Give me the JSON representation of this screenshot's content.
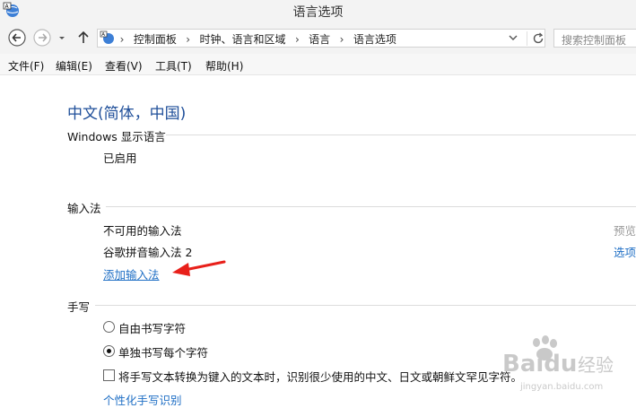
{
  "window": {
    "title": "语言选项"
  },
  "nav": {
    "breadcrumbs": [
      "控制面板",
      "时钟、语言和区域",
      "语言",
      "语言选项"
    ],
    "search_placeholder": "搜索控制面板"
  },
  "menu": [
    "文件(F)",
    "编辑(E)",
    "查看(V)",
    "工具(T)",
    "帮助(H)"
  ],
  "language": {
    "name": "中文(简体，中国)"
  },
  "display_section": {
    "header": "Windows 显示语言",
    "status": "已启用"
  },
  "input_section": {
    "header": "输入法",
    "methods": [
      {
        "label": "不可用的输入法",
        "action": "预览",
        "action_color": "#9a9a9a"
      },
      {
        "label": "谷歌拼音输入法 2",
        "action": "选项",
        "action_color": "#1f6fc5"
      }
    ],
    "add_link": "添加输入法"
  },
  "handwriting_section": {
    "header": "手写",
    "options": [
      {
        "label": "自由书写字符",
        "selected": false
      },
      {
        "label": "单独书写每个字符",
        "selected": true
      }
    ],
    "checkbox_label": "将手写文本转换为键入的文本时，识别很少使用的中文、日文或朝鲜文罕见字符。",
    "checkbox_checked": false,
    "personalize_link": "个性化手写识别"
  },
  "colors": {
    "accent": "#1f6fc5",
    "title_blue": "#1e4e99",
    "arrow_red": "#e8201a"
  },
  "watermark": {
    "brand": "Baidu",
    "suffix": "经验",
    "url": "jingyan.baidu.com"
  }
}
